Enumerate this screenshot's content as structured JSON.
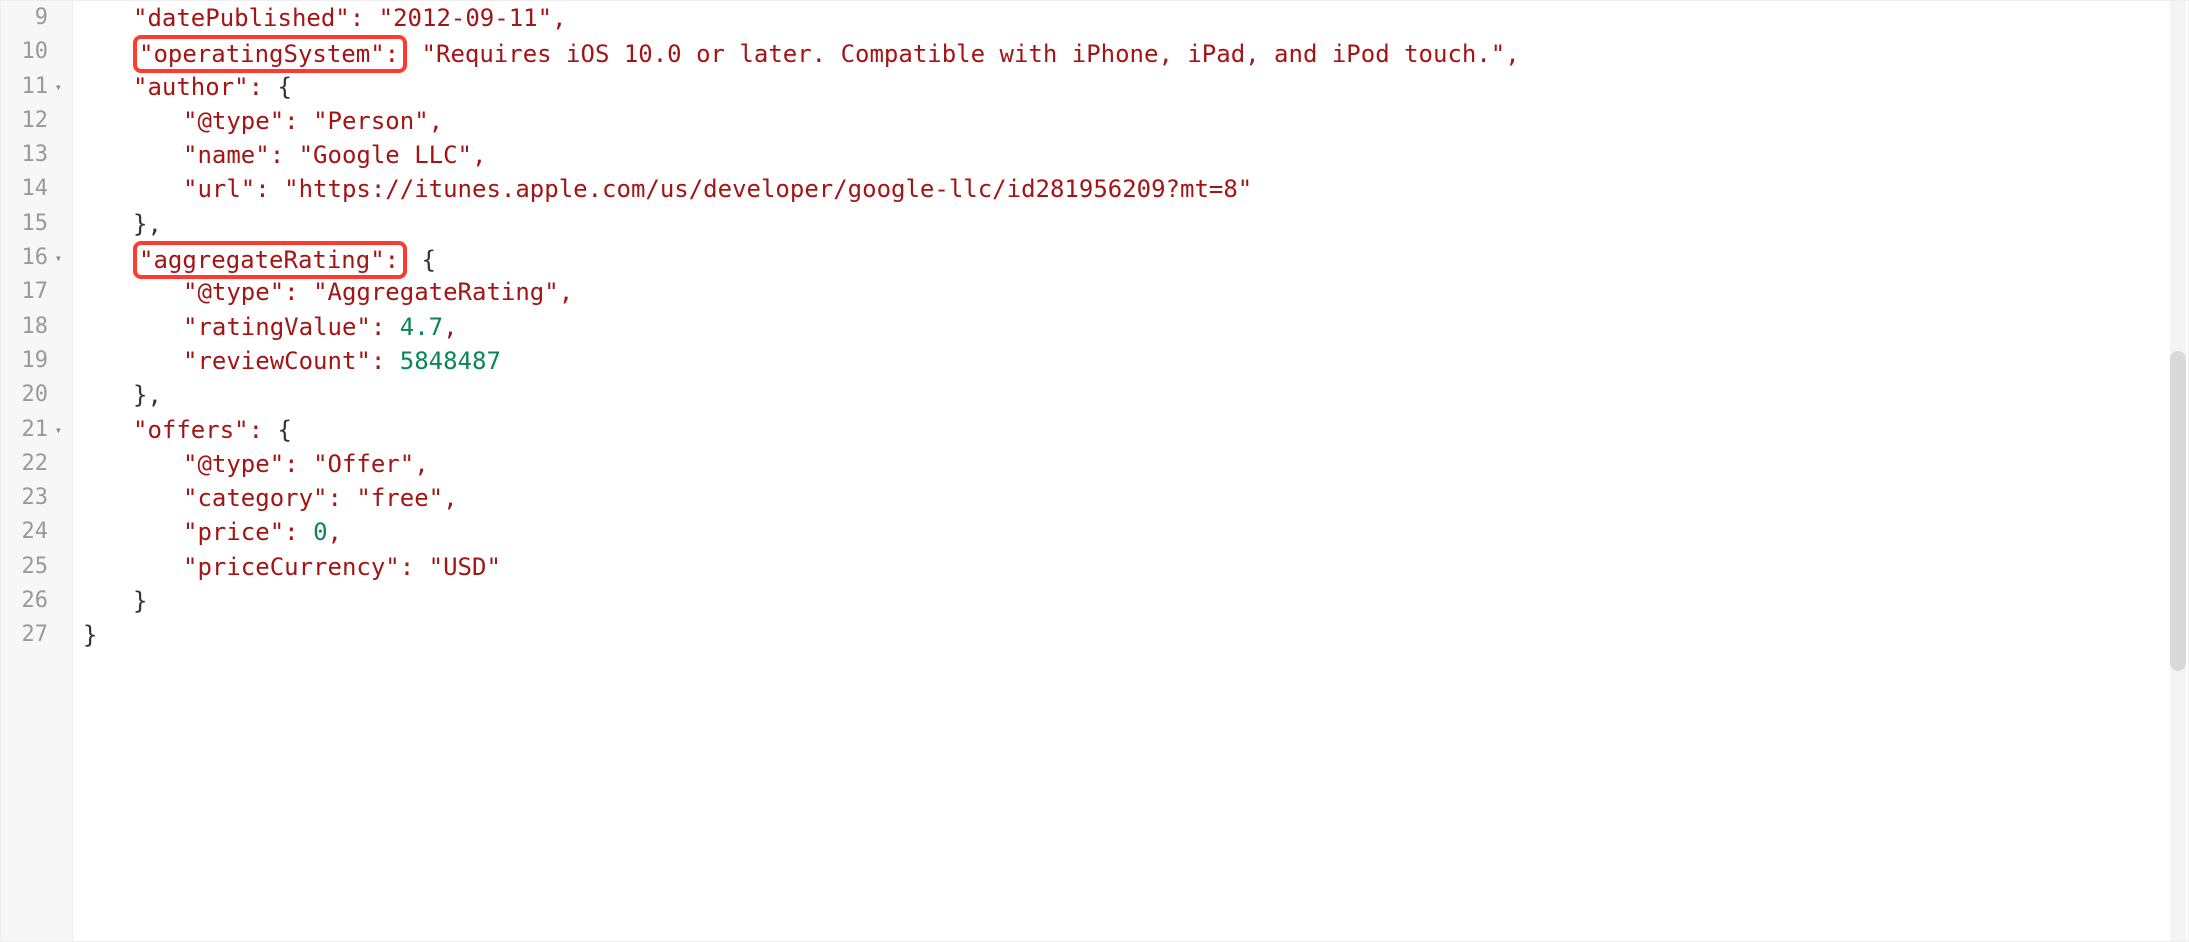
{
  "lines": [
    {
      "num": "9",
      "fold": "",
      "indent": 1,
      "pre": "",
      "key": "\"datePublished\"",
      "mid": ": ",
      "val": "\"2012-09-11\"",
      "valType": "str",
      "post": ",",
      "boxed": false,
      "openBrace": false,
      "closeBrace": false
    },
    {
      "num": "10",
      "fold": "",
      "indent": 1,
      "pre": "",
      "key": "\"operatingSystem\"",
      "mid": ": ",
      "val": "\"Requires iOS 10.0 or later. Compatible with iPhone, iPad, and iPod touch.\"",
      "valType": "str",
      "post": ",",
      "boxed": true,
      "openBrace": false,
      "closeBrace": false
    },
    {
      "num": "11",
      "fold": "▾",
      "indent": 1,
      "pre": "",
      "key": "\"author\"",
      "mid": ": ",
      "val": "{",
      "valType": "brace",
      "post": "",
      "boxed": false,
      "openBrace": true,
      "closeBrace": false
    },
    {
      "num": "12",
      "fold": "",
      "indent": 2,
      "pre": "",
      "key": "\"@type\"",
      "mid": ": ",
      "val": "\"Person\"",
      "valType": "str",
      "post": ",",
      "boxed": false,
      "openBrace": false,
      "closeBrace": false
    },
    {
      "num": "13",
      "fold": "",
      "indent": 2,
      "pre": "",
      "key": "\"name\"",
      "mid": ": ",
      "val": "\"Google LLC\"",
      "valType": "str",
      "post": ",",
      "boxed": false,
      "openBrace": false,
      "closeBrace": false
    },
    {
      "num": "14",
      "fold": "",
      "indent": 2,
      "pre": "",
      "key": "\"url\"",
      "mid": ": ",
      "val": "\"https://itunes.apple.com/us/developer/google-llc/id281956209?mt=8\"",
      "valType": "str",
      "post": "",
      "boxed": false,
      "openBrace": false,
      "closeBrace": false
    },
    {
      "num": "15",
      "fold": "",
      "indent": 1,
      "pre": "",
      "key": "",
      "mid": "",
      "val": "},",
      "valType": "brace",
      "post": "",
      "boxed": false,
      "openBrace": false,
      "closeBrace": true
    },
    {
      "num": "16",
      "fold": "▾",
      "indent": 1,
      "pre": "",
      "key": "\"aggregateRating\"",
      "mid": ": ",
      "val": "{",
      "valType": "brace",
      "post": "",
      "boxed": true,
      "openBrace": true,
      "closeBrace": false
    },
    {
      "num": "17",
      "fold": "",
      "indent": 2,
      "pre": "",
      "key": "\"@type\"",
      "mid": ": ",
      "val": "\"AggregateRating\"",
      "valType": "str",
      "post": ",",
      "boxed": false,
      "openBrace": false,
      "closeBrace": false
    },
    {
      "num": "18",
      "fold": "",
      "indent": 2,
      "pre": "",
      "key": "\"ratingValue\"",
      "mid": ": ",
      "val": "4.7",
      "valType": "num",
      "post": ",",
      "boxed": false,
      "openBrace": false,
      "closeBrace": false
    },
    {
      "num": "19",
      "fold": "",
      "indent": 2,
      "pre": "",
      "key": "\"reviewCount\"",
      "mid": ": ",
      "val": "5848487",
      "valType": "num",
      "post": "",
      "boxed": false,
      "openBrace": false,
      "closeBrace": false
    },
    {
      "num": "20",
      "fold": "",
      "indent": 1,
      "pre": "",
      "key": "",
      "mid": "",
      "val": "},",
      "valType": "brace",
      "post": "",
      "boxed": false,
      "openBrace": false,
      "closeBrace": true
    },
    {
      "num": "21",
      "fold": "▾",
      "indent": 1,
      "pre": "",
      "key": "\"offers\"",
      "mid": ": ",
      "val": "{",
      "valType": "brace",
      "post": "",
      "boxed": false,
      "openBrace": true,
      "closeBrace": false
    },
    {
      "num": "22",
      "fold": "",
      "indent": 2,
      "pre": "",
      "key": "\"@type\"",
      "mid": ": ",
      "val": "\"Offer\"",
      "valType": "str",
      "post": ",",
      "boxed": false,
      "openBrace": false,
      "closeBrace": false
    },
    {
      "num": "23",
      "fold": "",
      "indent": 2,
      "pre": "",
      "key": "\"category\"",
      "mid": ": ",
      "val": "\"free\"",
      "valType": "str",
      "post": ",",
      "boxed": false,
      "openBrace": false,
      "closeBrace": false
    },
    {
      "num": "24",
      "fold": "",
      "indent": 2,
      "pre": "",
      "key": "\"price\"",
      "mid": ": ",
      "val": "0",
      "valType": "num",
      "post": ",",
      "boxed": false,
      "openBrace": false,
      "closeBrace": false
    },
    {
      "num": "25",
      "fold": "",
      "indent": 2,
      "pre": "",
      "key": "\"priceCurrency\"",
      "mid": ": ",
      "val": "\"USD\"",
      "valType": "str",
      "post": "",
      "boxed": false,
      "openBrace": false,
      "closeBrace": false
    },
    {
      "num": "26",
      "fold": "",
      "indent": 1,
      "pre": "",
      "key": "",
      "mid": "",
      "val": "}",
      "valType": "brace",
      "post": "",
      "boxed": false,
      "openBrace": false,
      "closeBrace": true
    },
    {
      "num": "27",
      "fold": "",
      "indent": 0,
      "pre": "",
      "key": "",
      "mid": "",
      "val": "}",
      "valType": "brace",
      "post": "",
      "boxed": false,
      "openBrace": false,
      "closeBrace": true
    }
  ]
}
